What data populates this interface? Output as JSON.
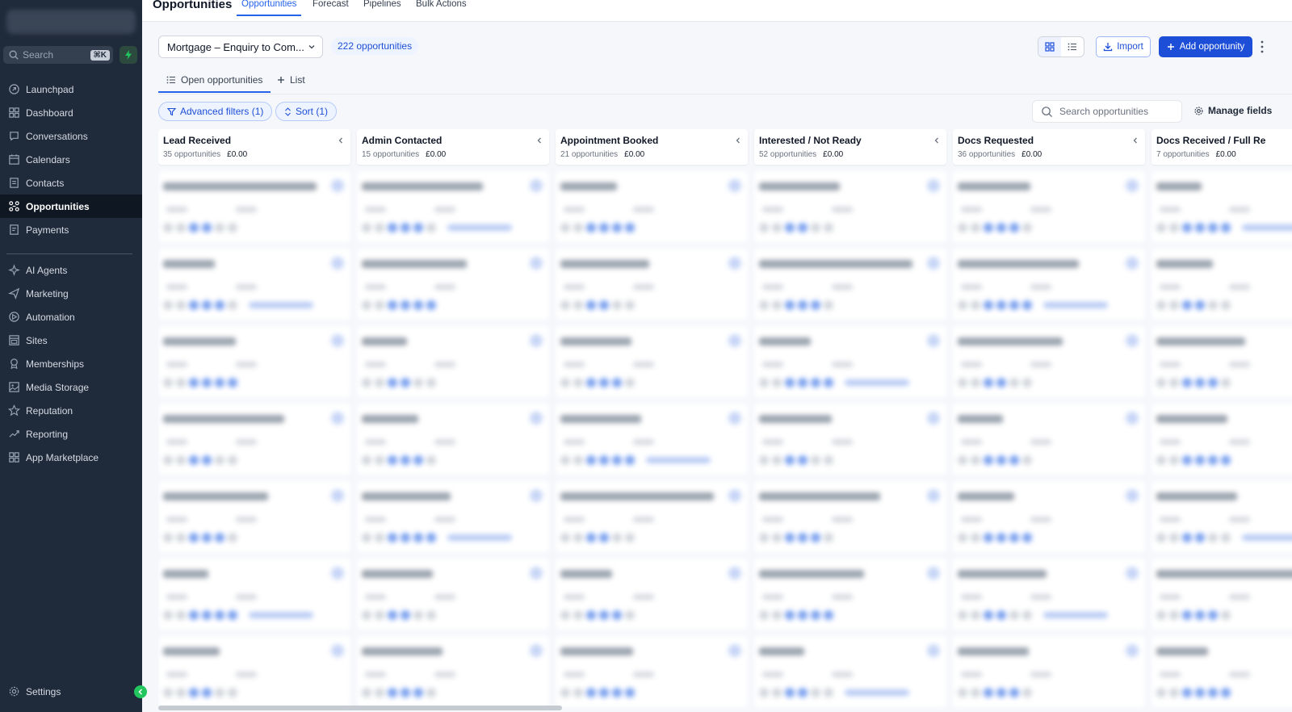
{
  "colors": {
    "sidebar_bg": "#1f2a3a",
    "accent": "#1d4ed8",
    "active_nav": "#0f1722",
    "bolt": "#22c55e"
  },
  "sidebar": {
    "search_placeholder": "Search",
    "search_shortcut": "⌘K",
    "items": [
      {
        "label": "Launchpad",
        "icon": "launchpad-icon"
      },
      {
        "label": "Dashboard",
        "icon": "dashboard-icon"
      },
      {
        "label": "Conversations",
        "icon": "chat-icon"
      },
      {
        "label": "Calendars",
        "icon": "calendar-icon"
      },
      {
        "label": "Contacts",
        "icon": "contacts-icon"
      },
      {
        "label": "Opportunities",
        "icon": "opportunities-icon",
        "active": true
      },
      {
        "label": "Payments",
        "icon": "payments-icon"
      }
    ],
    "items2": [
      {
        "label": "AI Agents",
        "icon": "ai-agents-icon"
      },
      {
        "label": "Marketing",
        "icon": "send-icon"
      },
      {
        "label": "Automation",
        "icon": "automation-icon"
      },
      {
        "label": "Sites",
        "icon": "sites-icon"
      },
      {
        "label": "Memberships",
        "icon": "membership-icon"
      },
      {
        "label": "Media Storage",
        "icon": "image-icon"
      },
      {
        "label": "Reputation",
        "icon": "star-icon"
      },
      {
        "label": "Reporting",
        "icon": "chart-icon"
      },
      {
        "label": "App Marketplace",
        "icon": "grid-icon"
      }
    ],
    "settings_label": "Settings"
  },
  "topbar": {
    "title": "Opportunities",
    "tabs": [
      "Opportunities",
      "Forecast",
      "Pipelines",
      "Bulk Actions"
    ]
  },
  "toolbar": {
    "pipeline": "Mortgage – Enquiry to Com...",
    "count": "222 opportunities",
    "import_label": "Import",
    "add_label": "Add opportunity"
  },
  "subtabs": {
    "open": "Open opportunities",
    "list": "List"
  },
  "filters": {
    "advanced": "Advanced filters (1)",
    "sort": "Sort (1)",
    "search_placeholder": "Search opportunities",
    "manage_fields": "Manage fields"
  },
  "columns": [
    {
      "title": "Lead Received",
      "count": "35 opportunities",
      "amount": "£0.00"
    },
    {
      "title": "Admin Contacted",
      "count": "15 opportunities",
      "amount": "£0.00"
    },
    {
      "title": "Appointment Booked",
      "count": "21 opportunities",
      "amount": "£0.00"
    },
    {
      "title": "Interested / Not Ready",
      "count": "52 opportunities",
      "amount": "£0.00"
    },
    {
      "title": "Docs Requested",
      "count": "36 opportunities",
      "amount": "£0.00"
    },
    {
      "title": "Docs Received / Full Re",
      "count": "7 opportunities",
      "amount": "£0.00"
    }
  ]
}
